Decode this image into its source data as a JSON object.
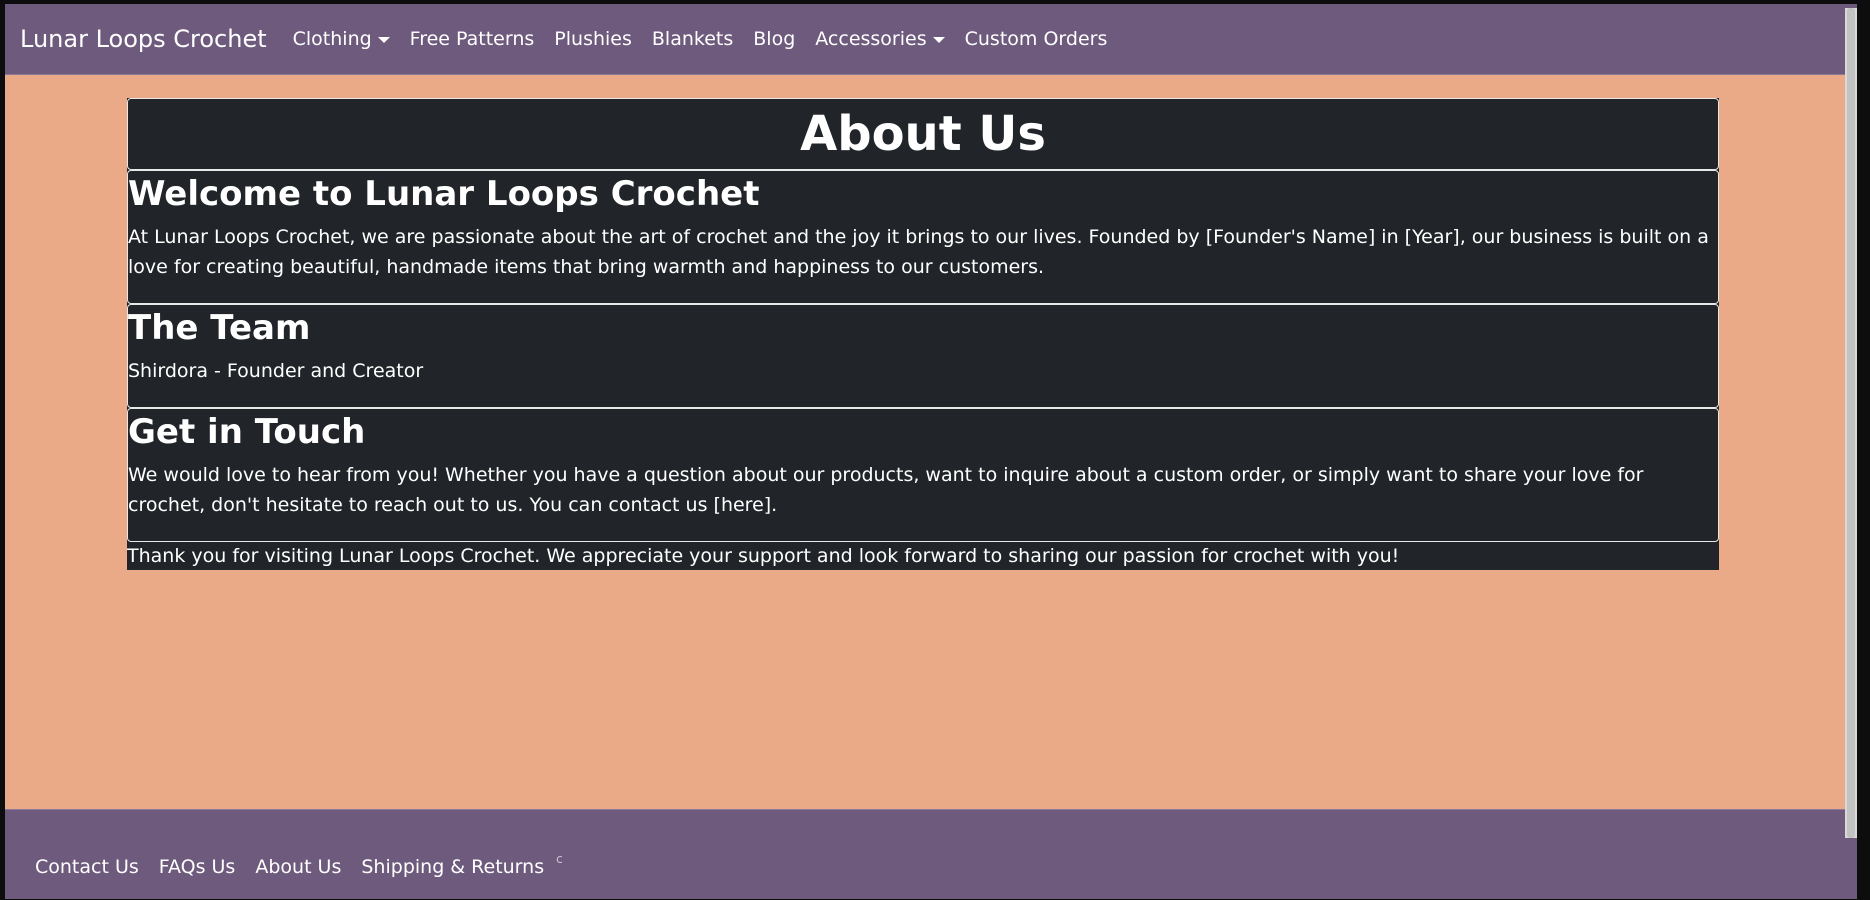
{
  "nav": {
    "brand": "Lunar Loops Crochet",
    "items": [
      {
        "label": "Clothing",
        "dropdown": true
      },
      {
        "label": "Free Patterns",
        "dropdown": false
      },
      {
        "label": "Plushies",
        "dropdown": false
      },
      {
        "label": "Blankets",
        "dropdown": false
      },
      {
        "label": "Blog",
        "dropdown": false
      },
      {
        "label": "Accessories",
        "dropdown": true
      },
      {
        "label": "Custom Orders",
        "dropdown": false
      }
    ]
  },
  "main": {
    "title": "About Us",
    "sections": [
      {
        "heading": "Welcome to Lunar Loops Crochet",
        "text": "At Lunar Loops Crochet, we are passionate about the art of crochet and the joy it brings to our lives. Founded by [Founder's Name] in [Year], our business is built on a love for creating beautiful, handmade items that bring warmth and happiness to our customers."
      },
      {
        "heading": "The Team",
        "text": "Shirdora - Founder and Creator"
      },
      {
        "heading": "Get in Touch",
        "text": "We would love to hear from you! Whether you have a question about our products, want to inquire about a custom order, or simply want to share your love for crochet, don't hesitate to reach out to us. You can contact us [here]."
      }
    ],
    "closing": "Thank you for visiting Lunar Loops Crochet. We appreciate your support and look forward to sharing our passion for crochet with you!"
  },
  "footer": {
    "links": [
      "Contact Us",
      "FAQs Us",
      "About Us",
      "Shipping & Returns"
    ],
    "mark": "c"
  },
  "colors": {
    "navbar": "#6e5a7d",
    "page_background": "#eaaa88",
    "content_background": "#212529",
    "text": "#ffffff"
  }
}
